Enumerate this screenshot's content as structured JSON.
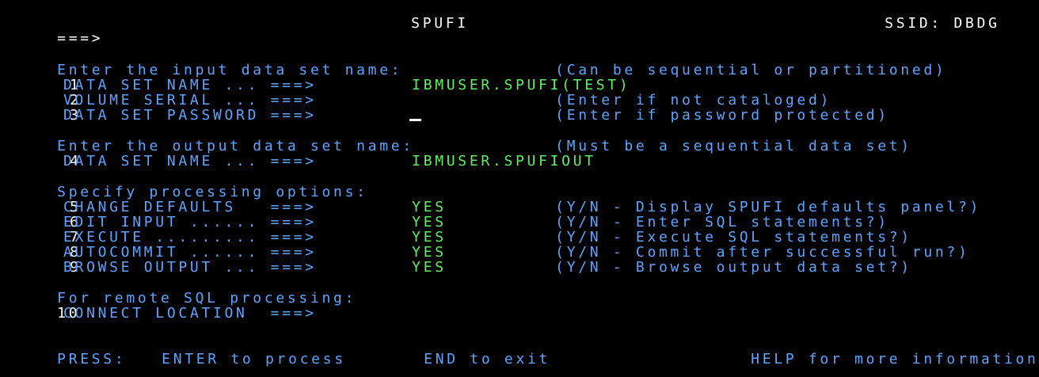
{
  "header": {
    "title": "SPUFI",
    "ssid": "SSID: DBDG",
    "command_prompt": "===>"
  },
  "input_section": {
    "heading": "Enter the input data set name:",
    "note": "(Can be sequential or partitioned)",
    "rows": [
      {
        "num": "1",
        "label": "DATA SET NAME ... ===>",
        "value": "IBMUSER.SPUFI(TEST)",
        "hint": ""
      },
      {
        "num": "2",
        "label": "VOLUME SERIAL ... ===>",
        "value": "",
        "hint": "(Enter if not cataloged)"
      },
      {
        "num": "3",
        "label": "DATA SET PASSWORD ===>",
        "value": "",
        "hint": "(Enter if password protected)"
      }
    ]
  },
  "output_section": {
    "heading": "Enter the output data set name:",
    "note": "(Must be a sequential data set)",
    "rows": [
      {
        "num": "4",
        "label": "DATA SET NAME ... ===>",
        "value": "IBMUSER.SPUFIOUT"
      }
    ]
  },
  "options_section": {
    "heading": "Specify processing options:",
    "rows": [
      {
        "num": "5",
        "label": "CHANGE DEFAULTS   ===>",
        "value": "YES",
        "hint": "(Y/N - Display SPUFI defaults panel?)"
      },
      {
        "num": "6",
        "label": "EDIT INPUT ...... ===>",
        "value": "YES",
        "hint": "(Y/N - Enter SQL statements?)"
      },
      {
        "num": "7",
        "label": "EXECUTE ......... ===>",
        "value": "YES",
        "hint": "(Y/N - Execute SQL statements?)"
      },
      {
        "num": "8",
        "label": "AUTOCOMMIT ...... ===>",
        "value": "YES",
        "hint": "(Y/N - Commit after successful run?)"
      },
      {
        "num": "9",
        "label": "BROWSE OUTPUT ... ===>",
        "value": "YES",
        "hint": "(Y/N - Browse output data set?)"
      }
    ]
  },
  "remote_section": {
    "heading": "For remote SQL processing:",
    "rows": [
      {
        "num": "10",
        "label": "CONNECT LOCATION  ===>",
        "value": ""
      }
    ]
  },
  "footer": {
    "press": "PRESS:",
    "enter": "ENTER to process",
    "end": "END to exit",
    "help": "HELP for more information"
  },
  "colors": {
    "background": "#000000",
    "text_white": "#ffffff",
    "text_blue": "#5ea4ff",
    "text_green": "#5ff05f"
  }
}
